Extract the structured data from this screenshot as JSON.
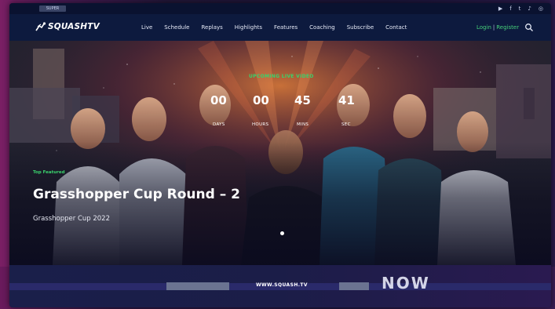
{
  "topbar": {
    "badge": "SUPER",
    "social_icons": [
      "youtube-icon",
      "facebook-icon",
      "twitter-icon",
      "tiktok-icon",
      "instagram-icon"
    ]
  },
  "brand": {
    "logo_text": "SQUASHTV"
  },
  "nav": {
    "items": [
      "Live",
      "Schedule",
      "Replays",
      "Highlights",
      "Features",
      "Coaching",
      "Subscribe",
      "Contact"
    ],
    "login": "Login",
    "separator": "|",
    "register": "Register"
  },
  "hero": {
    "countdown_title": "UPCOMING LIVE VIDEO",
    "countdown": [
      {
        "value": "00",
        "label": "DAYS"
      },
      {
        "value": "00",
        "label": "HOURS"
      },
      {
        "value": "45",
        "label": "MINS"
      },
      {
        "value": "41",
        "label": "SEC"
      }
    ],
    "tag": "Top Featured",
    "title": "Grasshopper Cup Round – 2",
    "subtitle": "Grasshopper Cup 2022",
    "active_slide": 1
  },
  "promo": {
    "url": "WWW.SQUASH.TV",
    "big_text": "NOW"
  },
  "colors": {
    "nav_bg": "#0d1a3e",
    "accent_green": "#39d36b",
    "frame_purple": "#7a1f64"
  }
}
